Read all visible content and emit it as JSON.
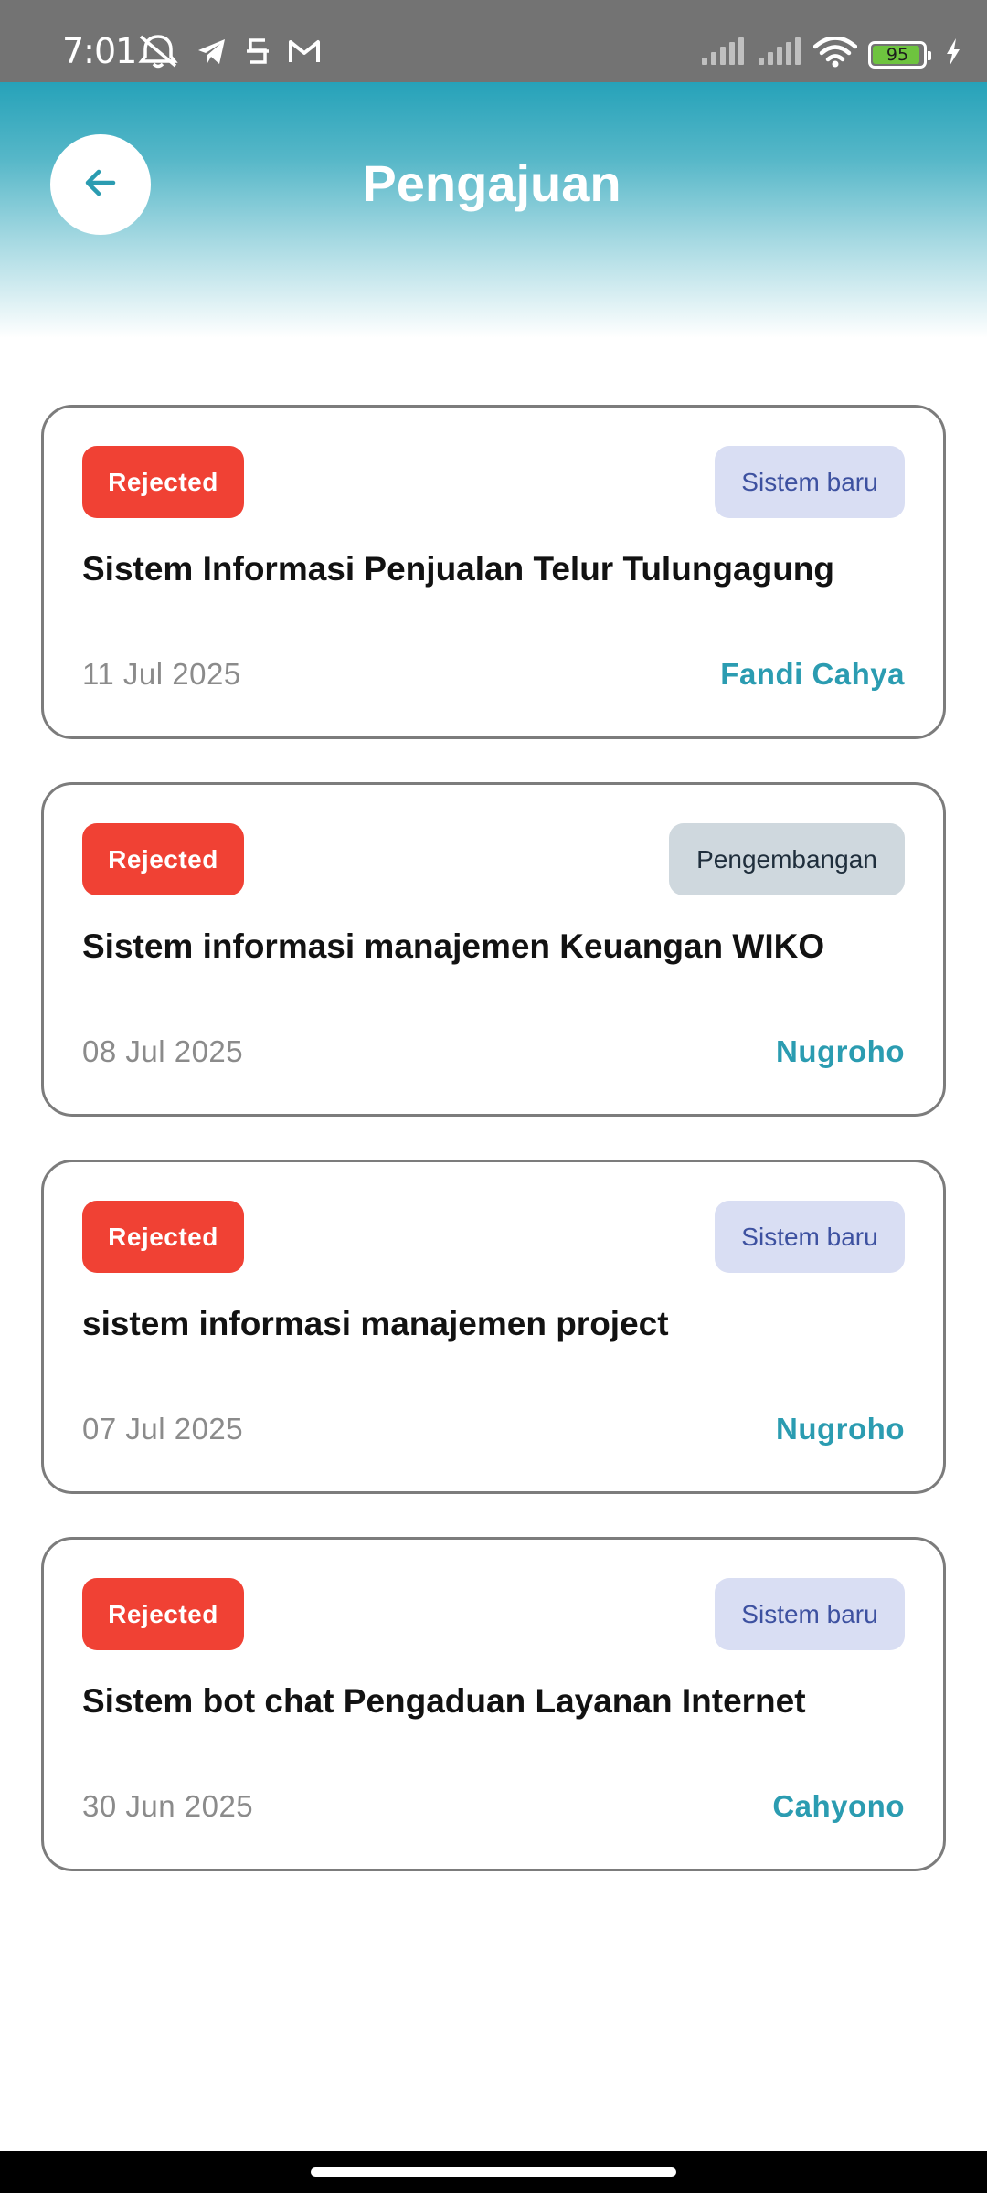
{
  "status_bar": {
    "time": "7:01",
    "battery_level": "95",
    "battery_fraction": 0.95,
    "left_icons": [
      "mute-alarm-icon",
      "telegram-icon",
      "app-icon",
      "gmail-icon"
    ],
    "right_icons": [
      "signal-icon",
      "signal-icon",
      "wifi-icon",
      "battery-icon",
      "charging-icon"
    ]
  },
  "header": {
    "title": "Pengajuan",
    "back_icon": "arrow-left-icon"
  },
  "colors": {
    "accent": "#2b9cb1",
    "rejected": "#f04134",
    "header_gradient_top": "#26a2b9",
    "badge_baru_bg": "#d9def3",
    "badge_baru_text": "#3d51a0",
    "badge_pengembangan_bg": "#cfd8de",
    "badge_pengembangan_text": "#1f2e3c"
  },
  "submissions": [
    {
      "status": "Rejected",
      "type": "Sistem baru",
      "title": "Sistem Informasi Penjualan Telur Tulungagung",
      "date": "11 Jul 2025",
      "author": "Fandi Cahya"
    },
    {
      "status": "Rejected",
      "type": "Pengembangan",
      "title": "Sistem informasi manajemen Keuangan WIKO",
      "date": "08 Jul 2025",
      "author": "Nugroho"
    },
    {
      "status": "Rejected",
      "type": "Sistem baru",
      "title": "sistem informasi manajemen project",
      "date": "07 Jul 2025",
      "author": "Nugroho"
    },
    {
      "status": "Rejected",
      "type": "Sistem baru",
      "title": "Sistem bot chat Pengaduan Layanan Internet",
      "date": "30 Jun 2025",
      "author": "Cahyono"
    }
  ]
}
